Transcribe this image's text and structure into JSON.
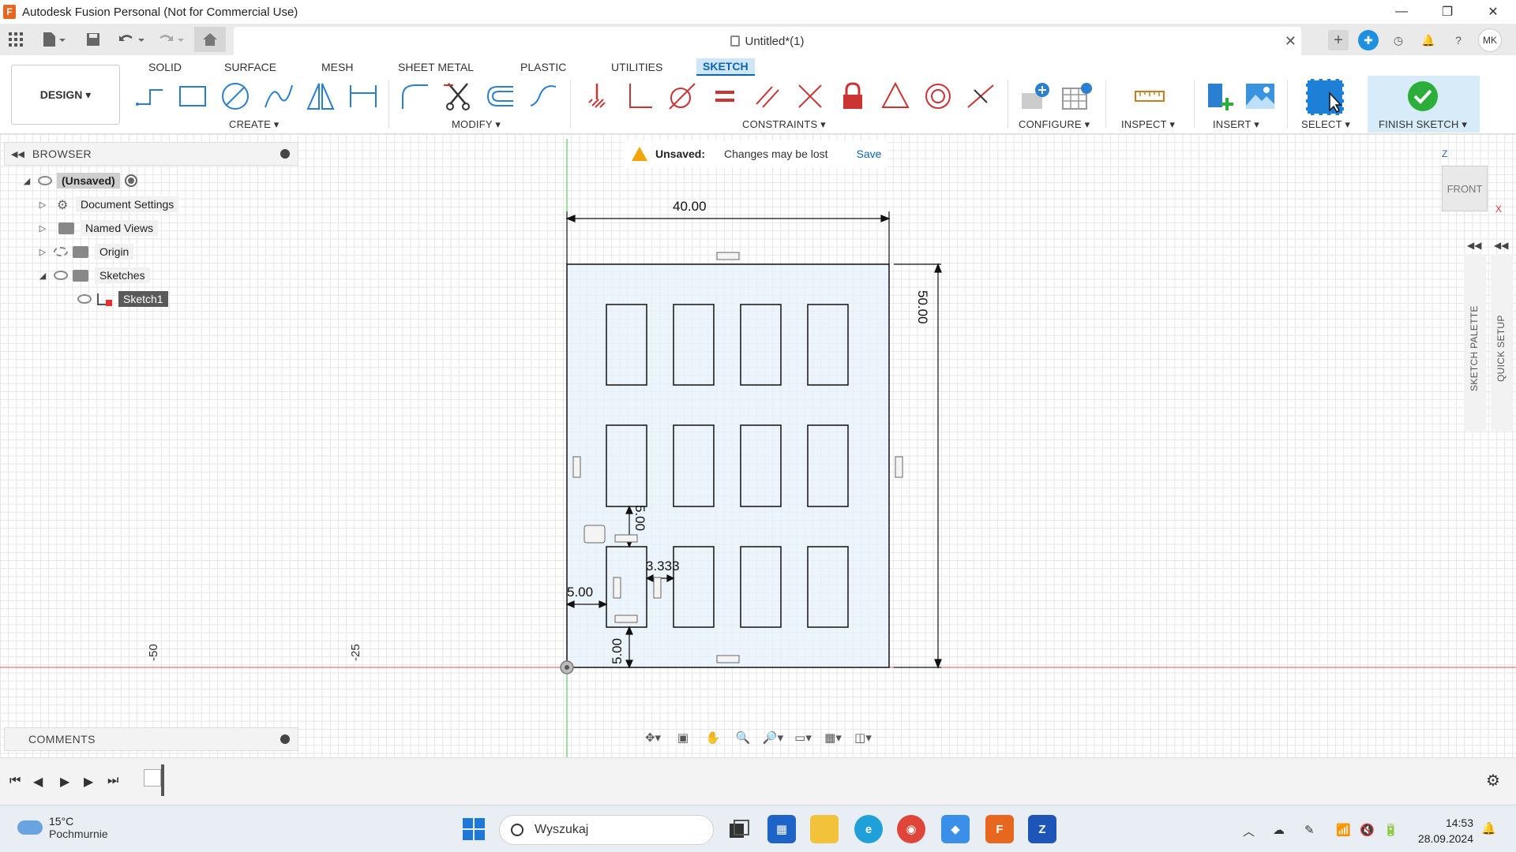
{
  "window": {
    "title": "Autodesk Fusion Personal (Not for Commercial Use)",
    "minimize": "—",
    "restore": "❐",
    "close": "✕"
  },
  "document": {
    "title": "Untitled*(1)",
    "close": "✕",
    "user_initials": "MK"
  },
  "ribbon": {
    "workspace": "DESIGN ▾",
    "tabs": [
      "SOLID",
      "SURFACE",
      "MESH",
      "SHEET METAL",
      "PLASTIC",
      "UTILITIES",
      "SKETCH"
    ],
    "active_tab": "SKETCH",
    "groups": {
      "create": "CREATE ▾",
      "modify": "MODIFY ▾",
      "constraints": "CONSTRAINTS ▾",
      "configure": "CONFIGURE ▾",
      "inspect": "INSPECT ▾",
      "insert": "INSERT ▾",
      "select": "SELECT ▾",
      "finish": "FINISH SKETCH ▾"
    }
  },
  "browser": {
    "title": "BROWSER",
    "items": [
      {
        "label": "(Unsaved)"
      },
      {
        "label": "Document Settings"
      },
      {
        "label": "Named Views"
      },
      {
        "label": "Origin"
      },
      {
        "label": "Sketches"
      },
      {
        "label": "Sketch1"
      }
    ]
  },
  "banner": {
    "status": "Unsaved:",
    "message": "Changes may be lost",
    "action": "Save"
  },
  "viewcube": {
    "face": "FRONT",
    "z": "Z",
    "x": "X"
  },
  "side_panels": {
    "sketch_palette": "SKETCH PALETTE",
    "quick_setup": "QUICK SETUP"
  },
  "comments": {
    "title": "COMMENTS"
  },
  "sketch": {
    "dim_width": "40.00",
    "dim_height": "50.00",
    "dim_left": "5.00",
    "dim_bottom": "5.00",
    "dim_gap_v": "5.00",
    "dim_gap_h": "3.333",
    "axis_label_a": "-50",
    "axis_label_b": "-25"
  },
  "taskbar": {
    "temperature": "15°C",
    "weather": "Pochmurnie",
    "search_placeholder": "Wyszukaj",
    "time": "14:53",
    "date": "28.09.2024"
  }
}
